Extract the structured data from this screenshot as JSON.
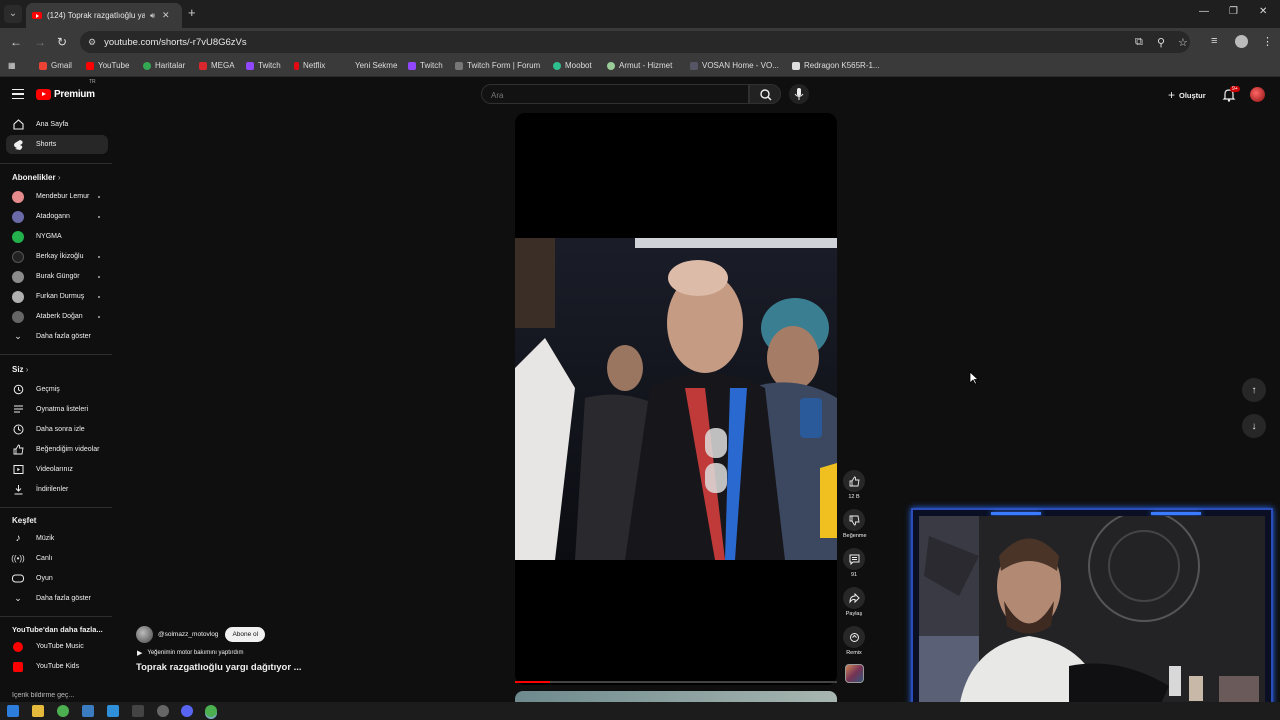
{
  "browser": {
    "tab_title": "(124) Toprak razgatlıoğlu ya",
    "url": "youtube.com/shorts/-r7vU8G6zVs",
    "bookmarks": [
      "Gmail",
      "YouTube",
      "Haritalar",
      "MEGA",
      "Twitch",
      "Netflix",
      "Yeni Sekme",
      "Twitch",
      "Twitch Form | Forum",
      "Moobot",
      "Armut - Hizmet",
      "VOSAN Home - VO...",
      "Redragon K565R-1..."
    ]
  },
  "youtube": {
    "logo_text": "Premium",
    "logo_region": "TR",
    "search_placeholder": "Ara",
    "create_label": "Oluştur",
    "notification_count": "9+"
  },
  "sidebar": {
    "main": [
      {
        "label": "Ana Sayfa",
        "icon": "home-icon"
      },
      {
        "label": "Shorts",
        "icon": "shorts-icon"
      }
    ],
    "subscriptions_heading": "Abonelikler",
    "subscriptions": [
      {
        "label": "Mendebur Lemur",
        "color": "#e58b8b",
        "live": true
      },
      {
        "label": "Atadogann",
        "color": "#6a6aa8",
        "live": true
      },
      {
        "label": "NYGMA",
        "color": "#22b14c",
        "live": false
      },
      {
        "label": "Berkay İkizoğlu",
        "color": "#222222",
        "live": true
      },
      {
        "label": "Burak Güngör",
        "color": "#8b8b8b",
        "live": true
      },
      {
        "label": "Furkan Durmuş",
        "color": "#b0b0b0",
        "live": true
      },
      {
        "label": "Ataberk Doğan",
        "color": "#666666",
        "live": true
      }
    ],
    "show_more_1": "Daha fazla göster",
    "you_heading": "Siz",
    "you_items": [
      {
        "label": "Geçmiş",
        "icon": "history-icon"
      },
      {
        "label": "Oynatma listeleri",
        "icon": "playlist-icon"
      },
      {
        "label": "Daha sonra izle",
        "icon": "clock-icon"
      },
      {
        "label": "Beğendiğim videolar",
        "icon": "like-icon"
      },
      {
        "label": "Videolarınız",
        "icon": "video-icon"
      },
      {
        "label": "İndirilenler",
        "icon": "download-icon"
      }
    ],
    "explore_heading": "Keşfet",
    "explore_items": [
      {
        "label": "Müzik",
        "icon": "music-icon"
      },
      {
        "label": "Canlı",
        "icon": "live-icon"
      },
      {
        "label": "Oyun",
        "icon": "gaming-icon"
      }
    ],
    "show_more_2": "Daha fazla göster",
    "more_heading": "YouTube'dan daha fazla...",
    "more_items": [
      {
        "label": "YouTube Music"
      },
      {
        "label": "YouTube Kids"
      }
    ],
    "cut_off_item": "İçerik bildirme geç..."
  },
  "short": {
    "channel_handle": "@solmazz_motovlog",
    "subscribe_label": "Abone ol",
    "track": "Yeğenimin motor bakımını yaptırdım",
    "title": "Toprak razgatlıoğlu yargı dağıtıyor ...",
    "progress": 0.11,
    "actions": {
      "likes": "12 B",
      "dislike": "Beğenme",
      "comments": "91",
      "share": "Paylaş",
      "remix": "Remix"
    }
  }
}
